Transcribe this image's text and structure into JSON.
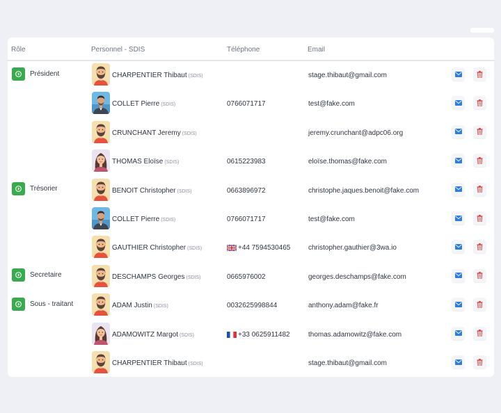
{
  "table": {
    "headers": {
      "role": "Rôle",
      "personnel": "Personnel - SDIS",
      "phone": "Téléphone",
      "email": "Email"
    },
    "rows": [
      {
        "role": "Président",
        "avatar": "man-beard",
        "name": "CHARPENTIER Thibaut",
        "tag": "(SDIS)",
        "phone": "",
        "flag": "",
        "email": "stage.thibaut@gmail.com"
      },
      {
        "role": "",
        "avatar": "man-photo",
        "name": "COLLET Pierre",
        "tag": "(SDIS)",
        "phone": "0766071717",
        "flag": "",
        "email": "test@fake.com"
      },
      {
        "role": "",
        "avatar": "man-beard",
        "name": "CRUNCHANT Jeremy",
        "tag": "(SDIS)",
        "phone": "",
        "flag": "",
        "email": "jeremy.crunchant@adpc06.org"
      },
      {
        "role": "",
        "avatar": "woman",
        "name": "THOMAS Eloïse",
        "tag": "(SDIS)",
        "phone": "0615223983",
        "flag": "",
        "email": "eloïse.thomas@fake.com"
      },
      {
        "role": "Trésorier",
        "avatar": "man-beard",
        "name": "BENOIT Christopher",
        "tag": "(SDIS)",
        "phone": "0663896972",
        "flag": "",
        "email": "christophe.jaques.benoit@fake.com"
      },
      {
        "role": "",
        "avatar": "man-photo",
        "name": "COLLET Pierre",
        "tag": "(SDIS)",
        "phone": "0766071717",
        "flag": "",
        "email": "test@fake.com"
      },
      {
        "role": "",
        "avatar": "man-beard",
        "name": "GAUTHIER Christopher",
        "tag": "(SDIS)",
        "phone": "+44 7594530465",
        "flag": "uk",
        "email": "christopher.gauthier@3wa.io"
      },
      {
        "role": "Secretaire",
        "avatar": "man-beard",
        "name": "DESCHAMPS Georges",
        "tag": "(SDIS)",
        "phone": "0665976002",
        "flag": "",
        "email": "georges.deschamps@fake.com"
      },
      {
        "role": "Sous - traitant",
        "avatar": "man-beard",
        "name": "ADAM Justin",
        "tag": "(SDIS)",
        "phone": "0032625998844",
        "flag": "",
        "email": "anthony.adam@fake.fr"
      },
      {
        "role": "",
        "avatar": "woman",
        "name": "ADAMOWITZ Margot",
        "tag": "(SDIS)",
        "phone": "+33 0625911482",
        "flag": "fr",
        "email": "thomas.adamowitz@fake.com"
      },
      {
        "role": "",
        "avatar": "man-beard",
        "name": "CHARPENTIER Thibaut",
        "tag": "(SDIS)",
        "phone": "",
        "flag": "",
        "email": "stage.thibaut@gmail.com"
      }
    ]
  },
  "icons": {
    "role": "chevron-right-icon",
    "mail": "envelope-icon",
    "delete": "trash-icon"
  },
  "colors": {
    "background": "#eef0f6",
    "role_chip": "#3aaa4e",
    "mail_icon": "#2f7de1",
    "delete_icon": "#e04a4a"
  }
}
